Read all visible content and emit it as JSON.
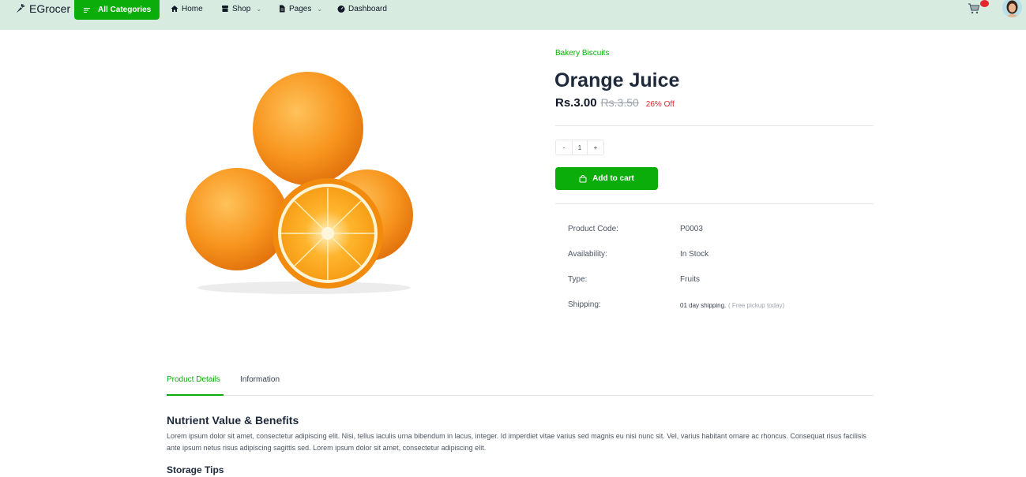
{
  "navbar": {
    "brand": "EGrocer",
    "categories_label": "All Categories",
    "items": [
      {
        "label": "Home",
        "icon": "home-icon"
      },
      {
        "label": "Shop",
        "icon": "store-icon",
        "dropdown": true
      },
      {
        "label": "Pages",
        "icon": "file-icon",
        "dropdown": true
      },
      {
        "label": "Dashboard",
        "icon": "speedometer-icon"
      }
    ]
  },
  "product": {
    "category": "Bakery Biscuits",
    "title": "Orange Juice",
    "price": "Rs.3.00",
    "old_price": "Rs.3.50",
    "discount": "26% Off",
    "quantity": {
      "minus": "-",
      "value": "1",
      "plus": "+"
    },
    "add_to_cart": "Add to cart",
    "info": [
      {
        "label": "Product Code:",
        "value": "P0003"
      },
      {
        "label": "Availability:",
        "value": "In Stock"
      },
      {
        "label": "Type:",
        "value": "Fruits"
      },
      {
        "label": "Shipping:",
        "value": "01 day shipping.",
        "note": "( Free pickup today)"
      }
    ]
  },
  "tabs": [
    {
      "label": "Product Details",
      "active": true
    },
    {
      "label": "Information",
      "active": false
    }
  ],
  "details": {
    "heading": "Nutrient Value & Benefits",
    "text": "Lorem ipsum dolor sit amet, consectetur adipiscing elit. Nisi, tellus iaculis urna bibendum in lacus, integer. Id imperdiet vitae varius sed magnis eu nisi nunc sit. Vel, varius habitant ornare ac rhoncus. Consequat risus facilisis ante ipsum netus risus adipiscing sagittis sed. Lorem ipsum dolor sit amet, consectetur adipiscing elit.",
    "storage_heading": "Storage Tips"
  },
  "colors": {
    "accent": "#0aad0a",
    "navbar_bg": "#d7ebe1",
    "discount": "#dc2626",
    "cart_badge": "#e5262d"
  }
}
